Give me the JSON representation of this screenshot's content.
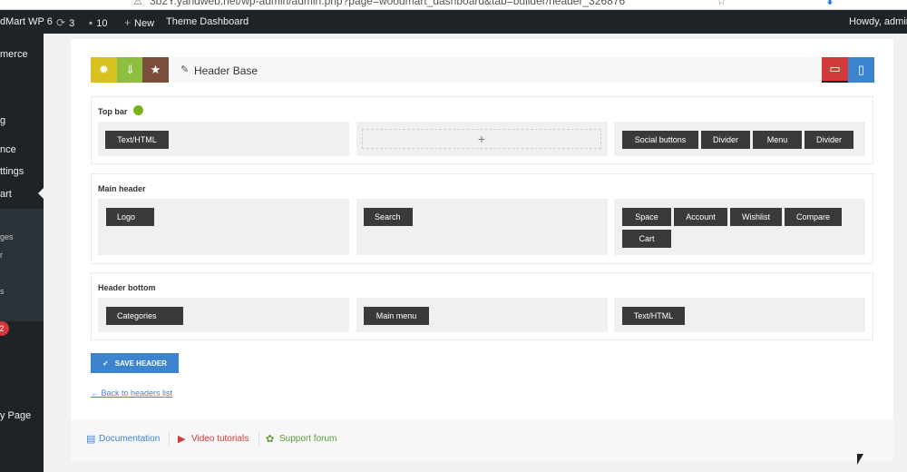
{
  "browser": {
    "url": "3b2Y.yandweb.net/wp-admin/admin.php?page=woodmart_dashboard&tab=builder/header_326876"
  },
  "adminbar": {
    "site": "dMart WP 6",
    "updates": "3",
    "comments": "10",
    "new": "New",
    "theme_dashboard": "Theme Dashboard",
    "howdy": "Howdy, admin"
  },
  "sidebar": {
    "items": [
      "merce",
      "g",
      "nce",
      "ttings",
      "art"
    ],
    "submenu": [
      "ges",
      "r",
      "",
      "s"
    ],
    "badge": "2",
    "bottom": "y Page"
  },
  "toolbar": {
    "title": "Header Base",
    "colors": {
      "yellow": "#d8c21f",
      "green": "#8cbf3f",
      "brown": "#7b4e3c",
      "red": "#d23a3a",
      "blue": "#3d84d0"
    }
  },
  "rows": {
    "top": {
      "label": "Top bar",
      "left": [
        "Text/HTML"
      ],
      "right": [
        "Social buttons",
        "Divider",
        "Menu",
        "Divider"
      ]
    },
    "main": {
      "label": "Main header",
      "left": [
        "Logo"
      ],
      "center": [
        "Search"
      ],
      "right": [
        "Space",
        "Account",
        "Wishlist",
        "Compare",
        "Cart"
      ]
    },
    "bottom": {
      "label": "Header bottom",
      "left": [
        "Categories"
      ],
      "center": [
        "Main menu"
      ],
      "right": [
        "Text/HTML"
      ]
    }
  },
  "actions": {
    "save": "SAVE HEADER",
    "back": "← Back to headers list"
  },
  "footer": {
    "documentation": "Documentation",
    "video": "Video tutorials",
    "support": "Support forum"
  }
}
